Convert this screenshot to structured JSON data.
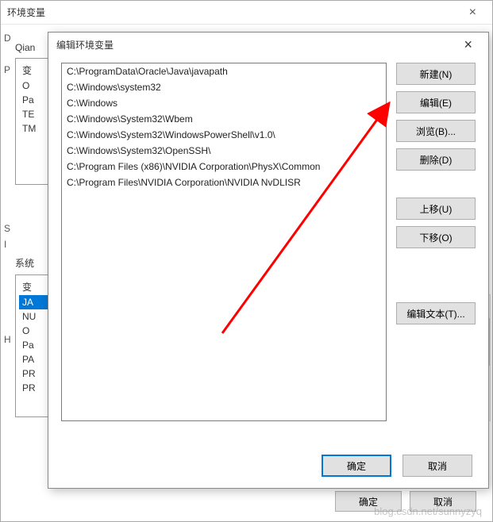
{
  "outer": {
    "title": "环境变量",
    "close": "×",
    "section1_label": "Qian",
    "section2_label": "系统",
    "list1_items": [
      "变",
      "O",
      "Pa",
      "TE",
      "TM"
    ],
    "list2_items": [
      "变",
      "JA",
      "NU",
      "O",
      "Pa",
      "PA",
      "PR",
      "PR"
    ],
    "ok": "确定",
    "cancel": "取消",
    "misc_labels": {
      "D": "D",
      "P": "P",
      "S": "S",
      "I": "I",
      "H": "H"
    }
  },
  "inner": {
    "title": "编辑环境变量",
    "close": "×",
    "paths": [
      "C:\\ProgramData\\Oracle\\Java\\javapath",
      "C:\\Windows\\system32",
      "C:\\Windows",
      "C:\\Windows\\System32\\Wbem",
      "C:\\Windows\\System32\\WindowsPowerShell\\v1.0\\",
      "C:\\Windows\\System32\\OpenSSH\\",
      "C:\\Program Files (x86)\\NVIDIA Corporation\\PhysX\\Common",
      "C:\\Program Files\\NVIDIA Corporation\\NVIDIA NvDLISR"
    ],
    "buttons": {
      "new": "新建(N)",
      "edit": "编辑(E)",
      "browse": "浏览(B)...",
      "delete": "删除(D)",
      "up": "上移(U)",
      "down": "下移(O)",
      "edit_text": "编辑文本(T)..."
    },
    "ok": "确定",
    "cancel": "取消"
  },
  "watermark": "blog.csdn.net/sunnyzyq",
  "annotation": {
    "arrow_color": "#ff0000",
    "arrow_target": "new-button"
  }
}
